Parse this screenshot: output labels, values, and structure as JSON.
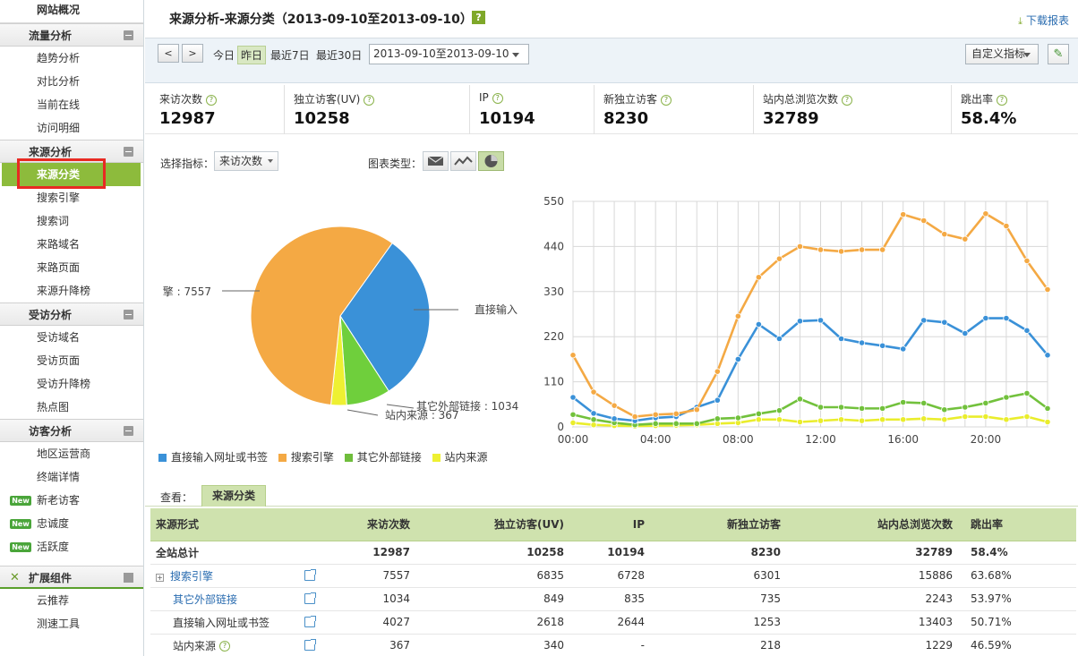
{
  "sidebar": {
    "top": "网站概况",
    "groups": [
      {
        "label": "流量分析",
        "items": [
          "趋势分析",
          "对比分析",
          "当前在线",
          "访问明细"
        ]
      },
      {
        "label": "来源分析",
        "items": [
          "来源分类",
          "搜索引擎",
          "搜索词",
          "来路域名",
          "来路页面",
          "来源升降榜"
        ]
      },
      {
        "label": "受访分析",
        "items": [
          "受访域名",
          "受访页面",
          "受访升降榜",
          "热点图"
        ]
      },
      {
        "label": "访客分析",
        "items": [
          "地区运营商",
          "终端详情",
          "新老访客",
          "忠诚度",
          "活跃度"
        ]
      },
      {
        "label": "扩展组件",
        "items": [
          "云推荐",
          "测速工具"
        ]
      }
    ],
    "new_badge": "New",
    "active_item": "来源分类"
  },
  "header": {
    "title": "来源分析-来源分类（2013-09-10至2013-09-10）",
    "help": "?",
    "download": "下载报表"
  },
  "toolbar": {
    "prev": "<",
    "next": ">",
    "quick_dates": [
      "今日",
      "昨日",
      "最近7日",
      "最近30日"
    ],
    "selected_quick": "昨日",
    "date_range": "2013-09-10至2013-09-10",
    "custom_indicator": "自定义指标"
  },
  "metrics": [
    {
      "label": "来访次数",
      "value": "12987"
    },
    {
      "label": "独立访客(UV)",
      "value": "10258"
    },
    {
      "label": "IP",
      "value": "10194"
    },
    {
      "label": "新独立访客",
      "value": "8230"
    },
    {
      "label": "站内总浏览次数",
      "value": "32789"
    },
    {
      "label": "跳出率",
      "value": "58.4%"
    }
  ],
  "chart_controls": {
    "select_label": "选择指标：",
    "selected_indicator": "来访次数",
    "type_label": "图表类型："
  },
  "colors": {
    "direct": "#3a91d8",
    "search": "#f4a944",
    "external": "#6fcf3c",
    "internal": "#eef032",
    "accent_green": "#8dbb3c"
  },
  "chart_data": [
    {
      "type": "pie",
      "slices": [
        {
          "name": "直接输入网址或书签",
          "value": 4027,
          "label": "直接输入"
        },
        {
          "name": "其它外部链接",
          "value": 1034,
          "label": "其它外部链接 : 1034"
        },
        {
          "name": "站内来源",
          "value": 367,
          "label": "站内来源 : 367"
        },
        {
          "name": "搜索引擎",
          "value": 7557,
          "label": "擎 : 7557"
        }
      ]
    },
    {
      "type": "line",
      "x": [
        "00:00",
        "01:00",
        "02:00",
        "03:00",
        "04:00",
        "05:00",
        "06:00",
        "07:00",
        "08:00",
        "09:00",
        "10:00",
        "11:00",
        "12:00",
        "13:00",
        "14:00",
        "15:00",
        "16:00",
        "17:00",
        "18:00",
        "19:00",
        "20:00",
        "21:00",
        "22:00",
        "23:00"
      ],
      "x_tick_labels": [
        "00:00",
        "04:00",
        "08:00",
        "12:00",
        "16:00",
        "20:00"
      ],
      "ylim": [
        0,
        550
      ],
      "y_ticks": [
        0,
        110,
        220,
        330,
        440,
        550
      ],
      "grid": true,
      "series": [
        {
          "name": "直接输入网址或书签",
          "values": [
            72,
            33,
            20,
            15,
            22,
            25,
            48,
            65,
            165,
            250,
            215,
            258,
            260,
            215,
            205,
            198,
            190,
            260,
            255,
            228,
            265,
            265,
            235,
            175
          ]
        },
        {
          "name": "搜索引擎",
          "values": [
            175,
            85,
            52,
            25,
            30,
            32,
            42,
            135,
            270,
            365,
            410,
            440,
            432,
            428,
            432,
            432,
            518,
            503,
            470,
            458,
            520,
            490,
            405,
            335
          ]
        },
        {
          "name": "其它外部链接",
          "values": [
            30,
            18,
            10,
            5,
            8,
            8,
            8,
            20,
            22,
            32,
            40,
            68,
            48,
            48,
            45,
            45,
            60,
            58,
            42,
            48,
            58,
            72,
            82,
            45
          ]
        },
        {
          "name": "站内来源",
          "values": [
            10,
            5,
            3,
            2,
            3,
            4,
            5,
            8,
            10,
            18,
            18,
            12,
            15,
            18,
            15,
            18,
            18,
            20,
            18,
            25,
            25,
            18,
            25,
            12
          ]
        }
      ]
    }
  ],
  "legend": [
    "直接输入网址或书签",
    "搜索引擎",
    "其它外部链接",
    "站内来源"
  ],
  "view": {
    "label": "查看：",
    "tab": "来源分类"
  },
  "table": {
    "headers": [
      "来源形式",
      "来访次数",
      "独立访客(UV)",
      "IP",
      "新独立访客",
      "站内总浏览次数",
      "跳出率"
    ],
    "rows": [
      {
        "name": "全站总计",
        "visits": "12987",
        "uv": "10258",
        "ip": "10194",
        "new_uv": "8230",
        "pv": "32789",
        "bounce": "58.4%"
      },
      {
        "name": "搜索引擎",
        "visits": "7557",
        "uv": "6835",
        "ip": "6728",
        "new_uv": "6301",
        "pv": "15886",
        "bounce": "63.68%"
      },
      {
        "name": "其它外部链接",
        "visits": "1034",
        "uv": "849",
        "ip": "835",
        "new_uv": "735",
        "pv": "2243",
        "bounce": "53.97%"
      },
      {
        "name": "直接输入网址或书签",
        "visits": "4027",
        "uv": "2618",
        "ip": "2644",
        "new_uv": "1253",
        "pv": "13403",
        "bounce": "50.71%"
      },
      {
        "name": "站内来源",
        "visits": "367",
        "uv": "340",
        "ip": "-",
        "new_uv": "218",
        "pv": "1229",
        "bounce": "46.59%"
      }
    ]
  }
}
